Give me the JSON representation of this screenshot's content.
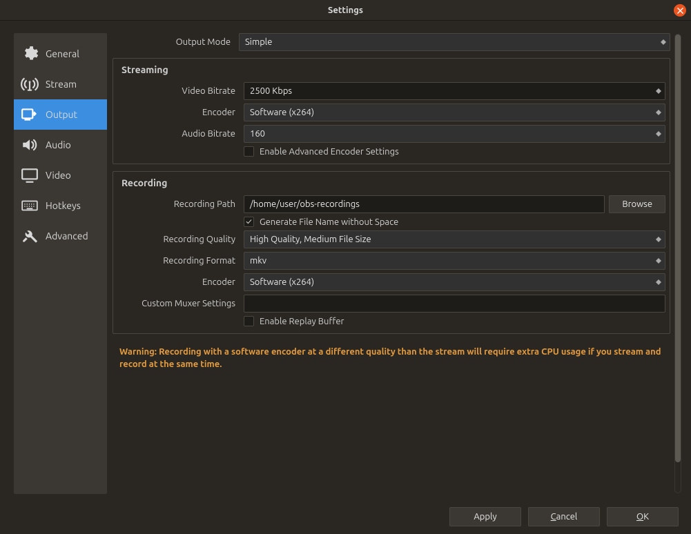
{
  "window": {
    "title": "Settings"
  },
  "sidebar": {
    "items": [
      {
        "label": "General"
      },
      {
        "label": "Stream"
      },
      {
        "label": "Output"
      },
      {
        "label": "Audio"
      },
      {
        "label": "Video"
      },
      {
        "label": "Hotkeys"
      },
      {
        "label": "Advanced"
      }
    ]
  },
  "output_mode": {
    "label": "Output Mode",
    "value": "Simple"
  },
  "streaming": {
    "title": "Streaming",
    "video_bitrate": {
      "label": "Video Bitrate",
      "value": "2500 Kbps"
    },
    "encoder": {
      "label": "Encoder",
      "value": "Software (x264)"
    },
    "audio_bitrate": {
      "label": "Audio Bitrate",
      "value": "160"
    },
    "advanced": {
      "label": "Enable Advanced Encoder Settings",
      "checked": false
    }
  },
  "recording": {
    "title": "Recording",
    "path": {
      "label": "Recording Path",
      "value": "/home/user/obs-recordings",
      "browse": "Browse"
    },
    "nospace": {
      "label": "Generate File Name without Space",
      "checked": true
    },
    "quality": {
      "label": "Recording Quality",
      "value": "High Quality, Medium File Size"
    },
    "format": {
      "label": "Recording Format",
      "value": "mkv"
    },
    "encoder": {
      "label": "Encoder",
      "value": "Software (x264)"
    },
    "muxer": {
      "label": "Custom Muxer Settings",
      "value": ""
    },
    "replay": {
      "label": "Enable Replay Buffer",
      "checked": false
    }
  },
  "warning": "Warning: Recording with a software encoder at a different quality than the stream will require extra CPU usage if you stream and record at the same time.",
  "footer": {
    "apply": "Apply",
    "cancel": "Cancel",
    "ok": "OK"
  }
}
